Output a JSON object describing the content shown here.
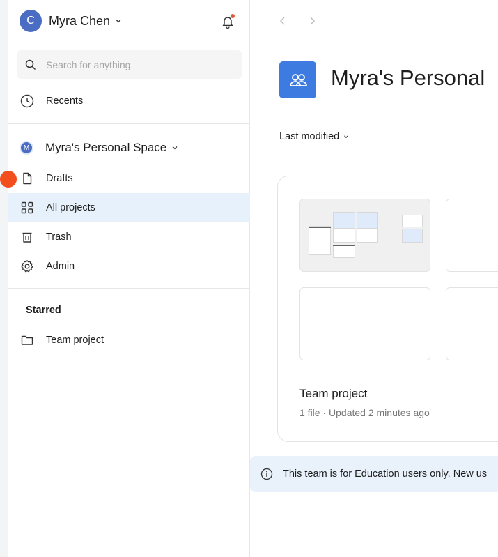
{
  "user": {
    "initial": "C",
    "name": "Myra Chen"
  },
  "search": {
    "placeholder": "Search for anything"
  },
  "nav": {
    "recents": "Recents",
    "drafts": "Drafts",
    "all_projects": "All projects",
    "trash": "Trash",
    "admin": "Admin"
  },
  "space": {
    "initial": "M",
    "name": "Myra's Personal Space"
  },
  "starred": {
    "heading": "Starred",
    "items": [
      {
        "label": "Team project"
      }
    ]
  },
  "main": {
    "title": "Myra's Personal",
    "sort_label": "Last modified",
    "project": {
      "name": "Team project",
      "meta": "1 file · Updated 2 minutes ago"
    },
    "banner": "This team is for Education users only. New us"
  },
  "colors": {
    "accent": "#3d7be0",
    "active_bg": "#e6f1fb",
    "cursor": "#f24e1e",
    "notification": "#e05a3a"
  },
  "icons": [
    "chevron-down-icon",
    "bell-icon",
    "search-icon",
    "clock-icon",
    "file-icon",
    "grid-icon",
    "trash-icon",
    "gear-icon",
    "folder-icon",
    "arrow-left-icon",
    "arrow-right-icon",
    "team-icon",
    "info-icon"
  ]
}
